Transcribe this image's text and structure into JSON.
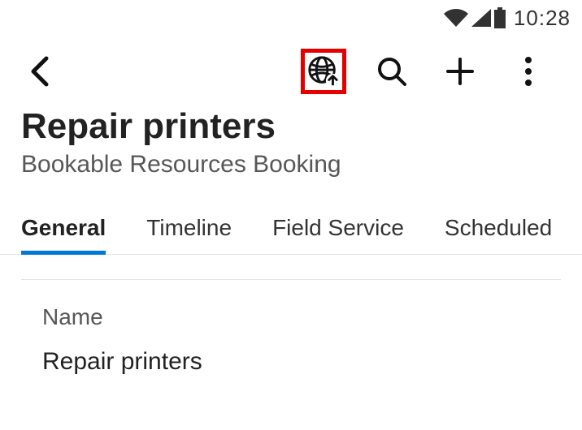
{
  "status_bar": {
    "time": "10:28"
  },
  "header": {
    "title": "Repair printers",
    "subtitle": "Bookable Resources Booking"
  },
  "tabs": [
    {
      "label": "General",
      "active": true
    },
    {
      "label": "Timeline",
      "active": false
    },
    {
      "label": "Field Service",
      "active": false
    },
    {
      "label": "Scheduled",
      "active": false
    }
  ],
  "form": {
    "fields": [
      {
        "label": "Name",
        "value": "Repair printers"
      }
    ]
  },
  "highlighted_action": "globe-sync-button"
}
